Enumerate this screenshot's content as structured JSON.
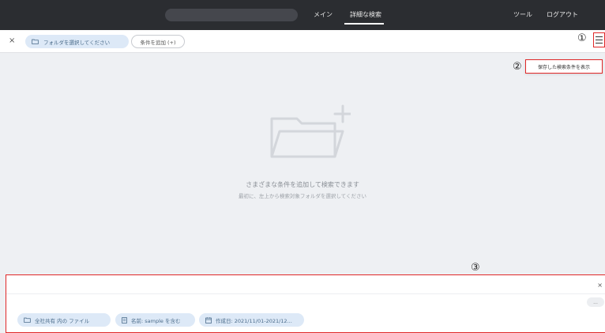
{
  "nav": {
    "main": "メイン",
    "advanced_search": "詳細な検索",
    "tools": "ツール",
    "logout": "ログアウト"
  },
  "filterbar": {
    "close": "×",
    "folder_chip": "フォルダを選択してください",
    "add_condition": "条件を追加 (+)",
    "callout_1": "①"
  },
  "dropdown": {
    "callout_2": "②",
    "show_saved": "保存した検索条件を表示"
  },
  "empty_state": {
    "main": "さまざまな条件を追加して検索できます",
    "sub": "最初に、左上から検索対象フォルダを選択してください"
  },
  "bottom_panel": {
    "callout_3": "③",
    "close": "×",
    "more": "...",
    "chips": {
      "scope": "全社共有 内の ファイル",
      "name": "名前: sample を含む",
      "date": "作成日: 2021/11/01-2021/12..."
    }
  },
  "colors": {
    "topbar": "#2b2d31",
    "chip_bg": "#dde9f7",
    "chip_text": "#4a6b8a",
    "highlight": "#e02828",
    "canvas": "#eef0f3"
  }
}
